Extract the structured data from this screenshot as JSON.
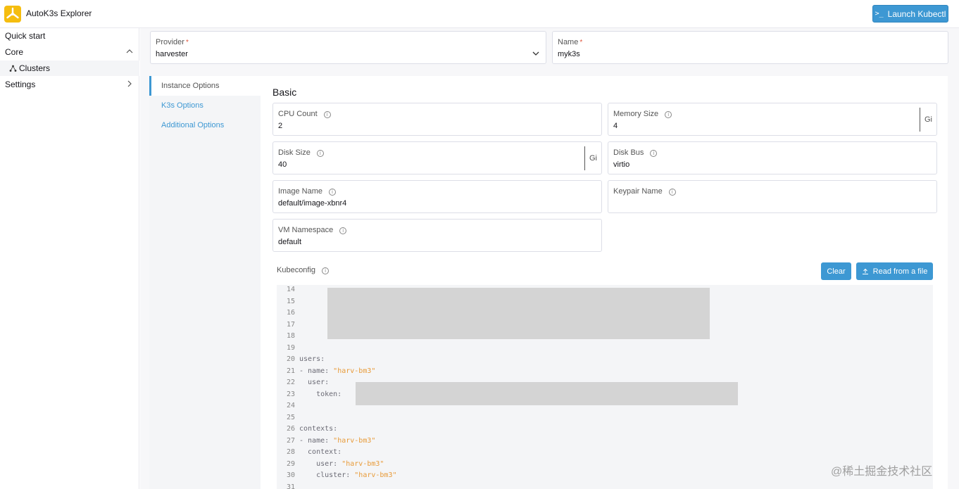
{
  "header": {
    "app_title": "AutoK3s Explorer",
    "launch_button": "Launch Kubectl",
    "launch_icon_glyph": ">_"
  },
  "sidebar": {
    "items": [
      {
        "label": "Quick start"
      },
      {
        "label": "Core"
      },
      {
        "label": "Clusters"
      },
      {
        "label": "Settings"
      }
    ]
  },
  "top_fields": {
    "provider": {
      "label": "Provider",
      "required_mark": "*",
      "value": "harvester"
    },
    "name": {
      "label": "Name",
      "required_mark": "*",
      "value": "myk3s"
    }
  },
  "tabs": [
    {
      "label": "Instance Options",
      "active": true
    },
    {
      "label": "K3s Options",
      "active": false
    },
    {
      "label": "Additional Options",
      "active": false
    }
  ],
  "section": {
    "title": "Basic"
  },
  "fields": {
    "cpu_count": {
      "label": "CPU Count",
      "value": "2"
    },
    "memory_size": {
      "label": "Memory Size",
      "value": "4",
      "unit": "Gi"
    },
    "disk_size": {
      "label": "Disk Size",
      "value": "40",
      "unit": "Gi"
    },
    "disk_bus": {
      "label": "Disk Bus",
      "value": "virtio"
    },
    "image_name": {
      "label": "Image Name",
      "value": "default/image-xbnr4"
    },
    "keypair_name": {
      "label": "Keypair Name",
      "value": ""
    },
    "vm_namespace": {
      "label": "VM Namespace",
      "value": "default"
    }
  },
  "kubeconfig": {
    "label": "Kubeconfig",
    "clear_button": "Clear",
    "read_button": "Read from a file",
    "lines": [
      {
        "n": "14",
        "text": ""
      },
      {
        "n": "15",
        "text": ""
      },
      {
        "n": "16",
        "text": ""
      },
      {
        "n": "17",
        "text": ""
      },
      {
        "n": "18",
        "text": ""
      },
      {
        "n": "19",
        "text": ""
      },
      {
        "n": "20",
        "key": "users:",
        "str": ""
      },
      {
        "n": "21",
        "key": "- name: ",
        "str": "\"harv-bm3\""
      },
      {
        "n": "22",
        "key": "  user:",
        "str": ""
      },
      {
        "n": "23",
        "key": "    token: ",
        "str": ""
      },
      {
        "n": "24",
        "text": ""
      },
      {
        "n": "25",
        "text": ""
      },
      {
        "n": "26",
        "key": "contexts:",
        "str": ""
      },
      {
        "n": "27",
        "key": "- name: ",
        "str": "\"harv-bm3\""
      },
      {
        "n": "28",
        "key": "  context:",
        "str": ""
      },
      {
        "n": "29",
        "key": "    user: ",
        "str": "\"harv-bm3\""
      },
      {
        "n": "30",
        "key": "    cluster: ",
        "str": "\"harv-bm3\""
      },
      {
        "n": "31",
        "text": ""
      }
    ]
  },
  "watermark": "@稀土掘金技术社区",
  "colors": {
    "accent": "#3d98d3",
    "logo": "#f5bd0f",
    "string": "#e89b39"
  }
}
